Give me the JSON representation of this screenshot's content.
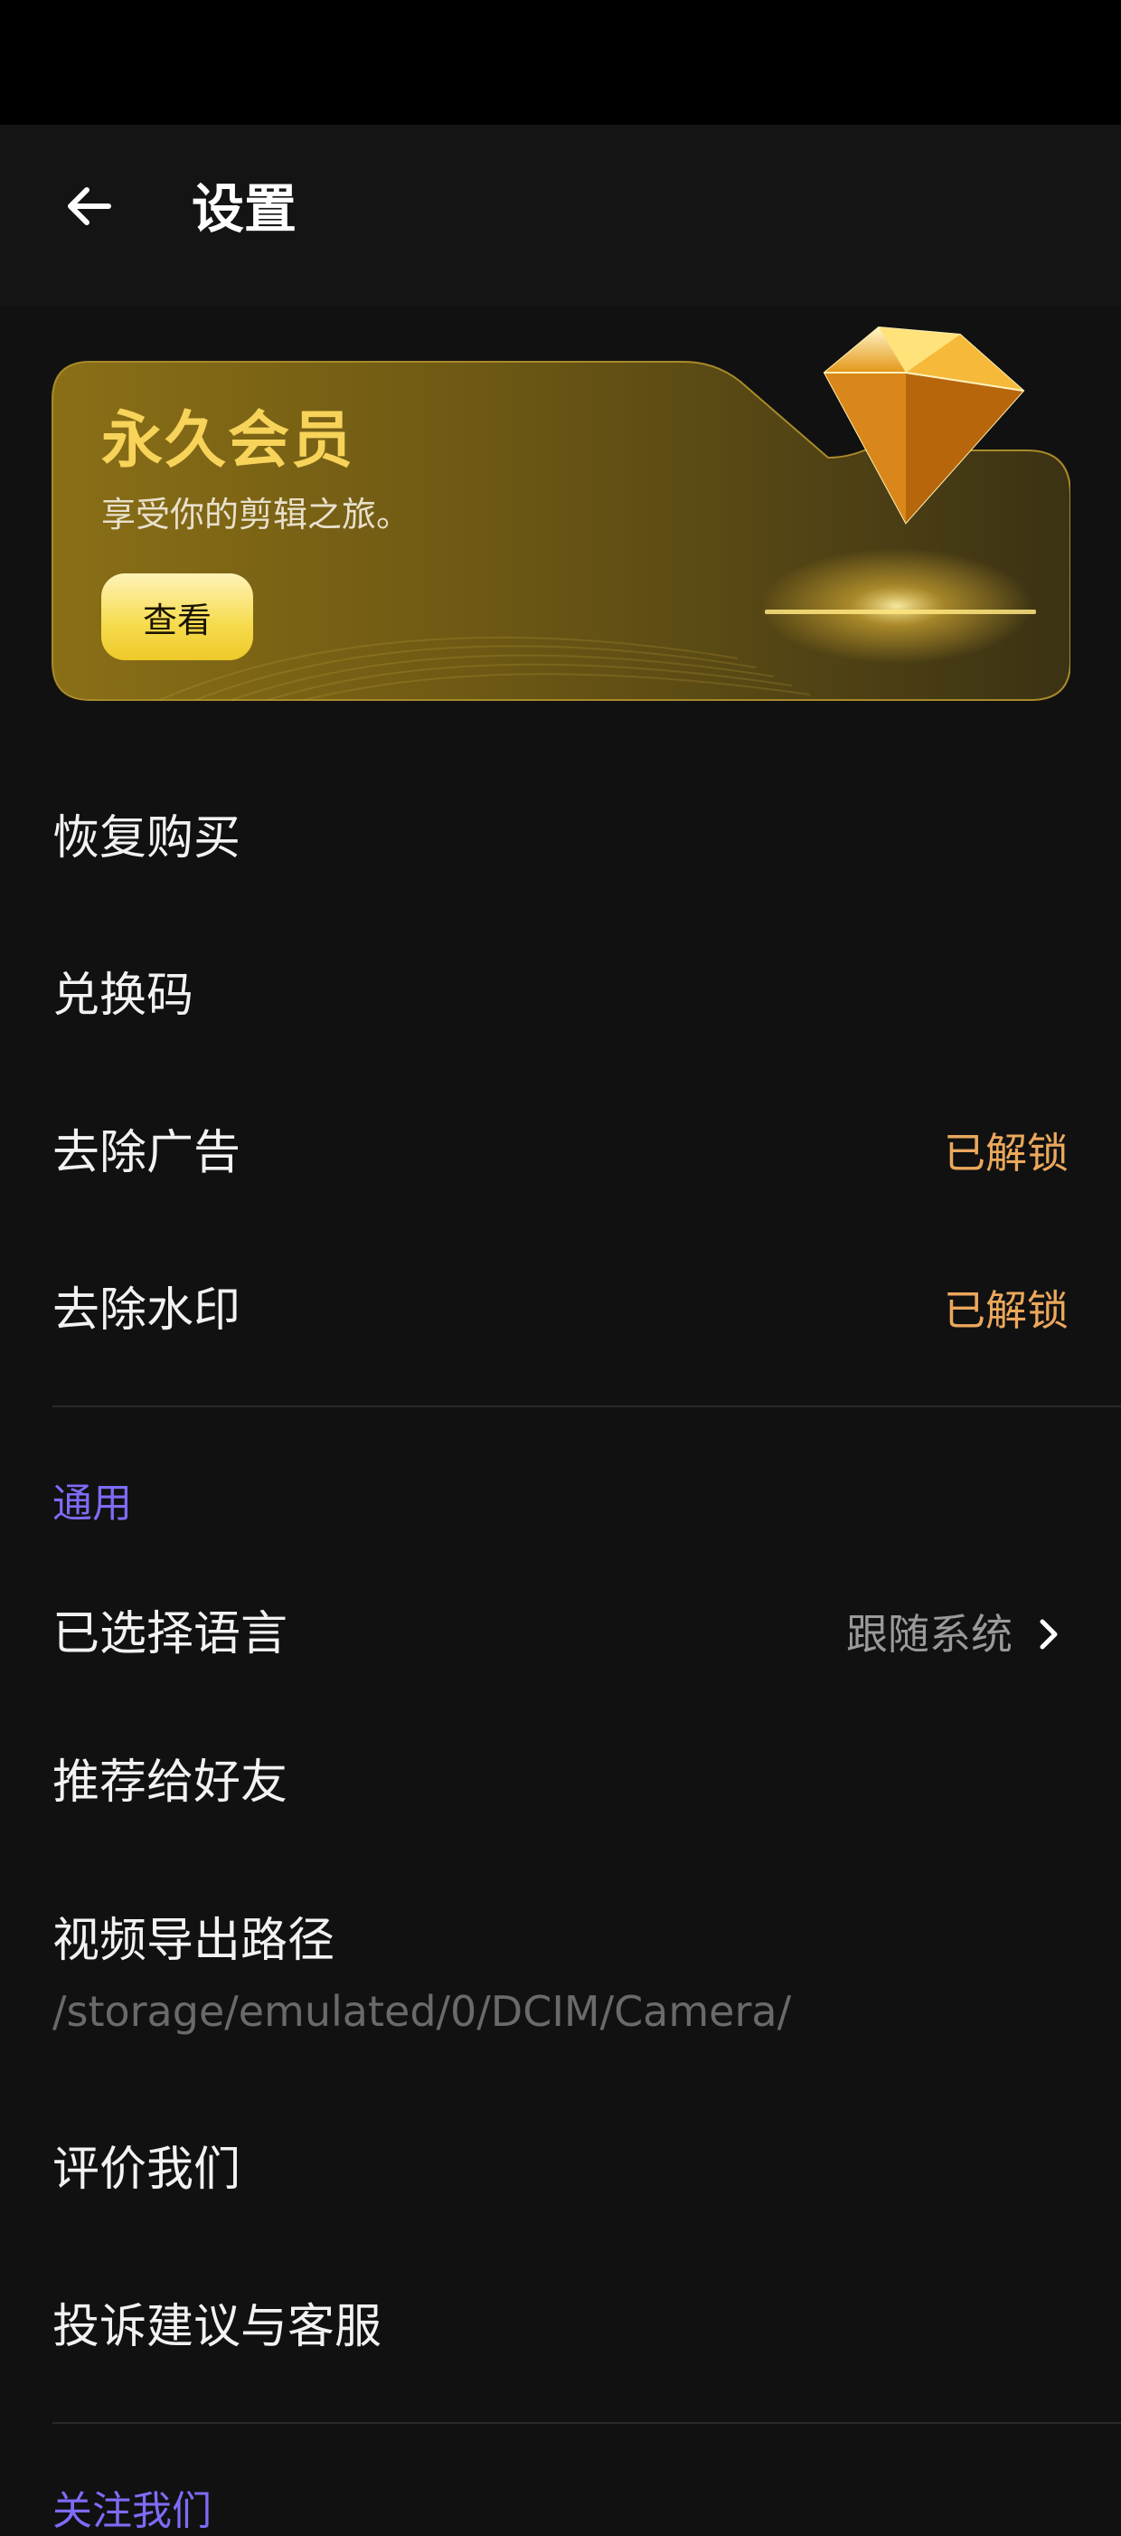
{
  "header": {
    "title": "设置"
  },
  "vip": {
    "title": "永久会员",
    "subtitle": "享受你的剪辑之旅。",
    "button_label": "查看"
  },
  "purchase_items": [
    {
      "label": "恢复购买"
    },
    {
      "label": "兑换码"
    },
    {
      "label": "去除广告",
      "status": "已解锁"
    },
    {
      "label": "去除水印",
      "status": "已解锁"
    }
  ],
  "general": {
    "section_title": "通用",
    "language": {
      "label": "已选择语言",
      "value": "跟随系统"
    },
    "recommend": {
      "label": "推荐给好友"
    },
    "export_path": {
      "label": "视频导出路径",
      "value": "/storage/emulated/0/DCIM/Camera/"
    },
    "rate": {
      "label": "评价我们"
    },
    "feedback": {
      "label": "投诉建议与客服"
    }
  },
  "follow_section_title": "关注我们",
  "colors": {
    "accent_purple": "#7d6cf7",
    "unlocked_orange": "#eba85c",
    "vip_gold": "#f7d35a",
    "background": "#111111"
  }
}
